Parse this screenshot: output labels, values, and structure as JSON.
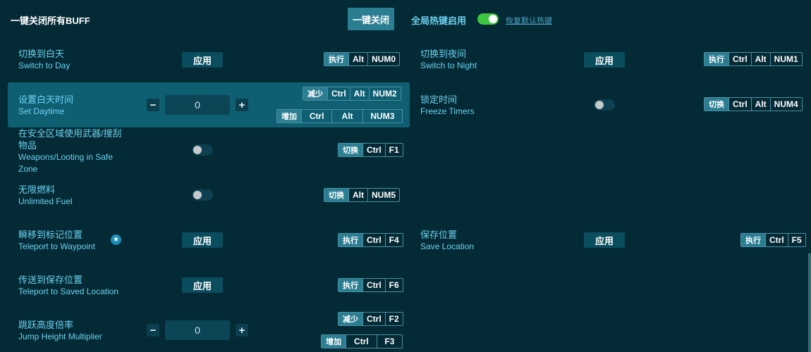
{
  "header": {
    "title": "一键关闭所有BUFF",
    "close_all_label": "一键关闭",
    "global_hotkey_label": "全局热键启用",
    "restore_label": "恢复默认热键"
  },
  "common": {
    "apply": "应用",
    "exec": "执行",
    "toggle": "切换",
    "decrease": "减少",
    "increase": "增加"
  },
  "items": {
    "switch_day": {
      "zh": "切换到白天",
      "en": "Switch to Day",
      "keys": [
        "Alt",
        "NUM0"
      ]
    },
    "switch_night": {
      "zh": "切换到夜间",
      "en": "Switch to Night",
      "keys": [
        "Ctrl",
        "Alt",
        "NUM1"
      ]
    },
    "set_daytime": {
      "zh": "设置白天时间",
      "en": "Set Daytime",
      "value": "0",
      "dec_keys": [
        "Ctrl",
        "Alt",
        "NUM2"
      ],
      "inc_keys": [
        "Ctrl",
        "Alt",
        "NUM3"
      ]
    },
    "freeze_timers": {
      "zh": "锁定时间",
      "en": "Freeze Timers",
      "keys": [
        "Ctrl",
        "Alt",
        "NUM4"
      ]
    },
    "weapons_safe": {
      "zh1": "在安全区域使用武器/搜刮",
      "zh2": "物品",
      "en1": "Weapons/Looting in Safe",
      "en2": "Zone",
      "keys": [
        "Ctrl",
        "F1"
      ]
    },
    "unlimited_fuel": {
      "zh": "无限燃料",
      "en": "Unlimited Fuel",
      "keys": [
        "Alt",
        "NUM5"
      ]
    },
    "teleport_waypoint": {
      "zh": "瞬移到标记位置",
      "en": "Teleport to Waypoint",
      "keys": [
        "Ctrl",
        "F4"
      ]
    },
    "save_location": {
      "zh": "保存位置",
      "en": "Save Location",
      "keys": [
        "Ctrl",
        "F5"
      ]
    },
    "teleport_saved": {
      "zh": "传送到保存位置",
      "en": "Teleport to Saved Location",
      "keys": [
        "Ctrl",
        "F6"
      ]
    },
    "jump_height": {
      "zh": "跳跃高度倍率",
      "en": "Jump Height Multiplier",
      "value": "0",
      "dec_keys": [
        "Ctrl",
        "F2"
      ],
      "inc_keys": [
        "Ctrl",
        "F3"
      ]
    }
  },
  "icons": {
    "minus": "−",
    "plus": "+",
    "star": "★"
  },
  "colors": {
    "background": "#032a35",
    "accent": "#2b7d91",
    "text_cyan": "#6ed1ee",
    "toggle_on": "#3ec641"
  }
}
